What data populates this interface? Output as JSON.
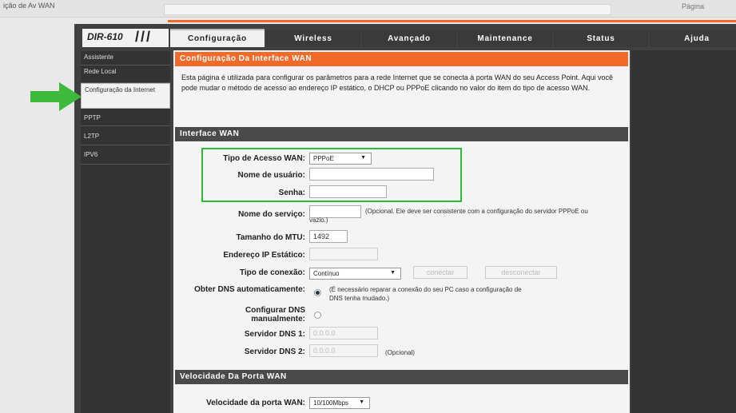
{
  "browser": {
    "title": "ição de Av WAN",
    "right_text": "Página"
  },
  "logo": {
    "model": "DIR-610",
    "slashes": "///"
  },
  "tabs": [
    {
      "label": "Configuração",
      "active": true
    },
    {
      "label": "Wireless",
      "active": false
    },
    {
      "label": "Avançado",
      "active": false
    },
    {
      "label": "Maintenance",
      "active": false
    },
    {
      "label": "Status",
      "active": false
    },
    {
      "label": "Ajuda",
      "active": false
    }
  ],
  "sidebar": {
    "items": [
      {
        "label": "Assistente"
      },
      {
        "label": "Rede Local"
      },
      {
        "label": "Configuração da Internet",
        "active": true
      },
      {
        "label": "PPTP"
      },
      {
        "label": "L2TP"
      },
      {
        "label": "IPV6"
      }
    ]
  },
  "main": {
    "title": "Configuração Da Interface WAN",
    "intro": "Esta página é utilizada para configurar os parâmetros para a rede Internet que se conecta à porta WAN do seu Access Point. Aqui você pode mudar o método de acesso ao endereço IP estático, o DHCP ou PPPoE clicando no valor do item do tipo de acesso WAN.",
    "section_wan": "Interface WAN",
    "section_speed": "Velocidade Da Porta WAN"
  },
  "form": {
    "tipo_acesso_label": "Tipo de Acesso WAN:",
    "tipo_acesso_value": "PPPoE",
    "usuario_label": "Nome de usuário:",
    "usuario_value": "",
    "senha_label": "Senha:",
    "senha_value": "",
    "servico_label": "Nome do serviço:",
    "servico_note": "(Opcional. Ele deve ser consistente com a configuração do servidor PPPoE ou vazio.)",
    "mtu_label": "Tamanho do MTU:",
    "mtu_value": "1492",
    "ip_estatico_label": "Endereço IP Estático:",
    "tipo_conexao_label": "Tipo de conexão:",
    "tipo_conexao_value": "Contínuo",
    "conectar_label": "conectar",
    "desconectar_label": "desconectar",
    "obter_dns_label": "Obter DNS automaticamente:",
    "obter_dns_note": "(É necessário reparar a conexão do seu PC caso a configuração de DNS tenha mudado.)",
    "config_dns_label": "Configurar DNS manualmente:",
    "dns1_label": "Servidor DNS 1:",
    "dns1_value": "0.0.0.0",
    "dns2_label": "Servidor DNS 2:",
    "dns2_value": "0.0.0.0",
    "dns2_note": "(Opcional)",
    "velocidade_label": "Velocidade da porta WAN:",
    "velocidade_value": "10/100Mbps"
  },
  "colors": {
    "accent_orange": "#f26a2a",
    "highlight_green": "#2dbb3c",
    "dark_bg": "#404040"
  }
}
